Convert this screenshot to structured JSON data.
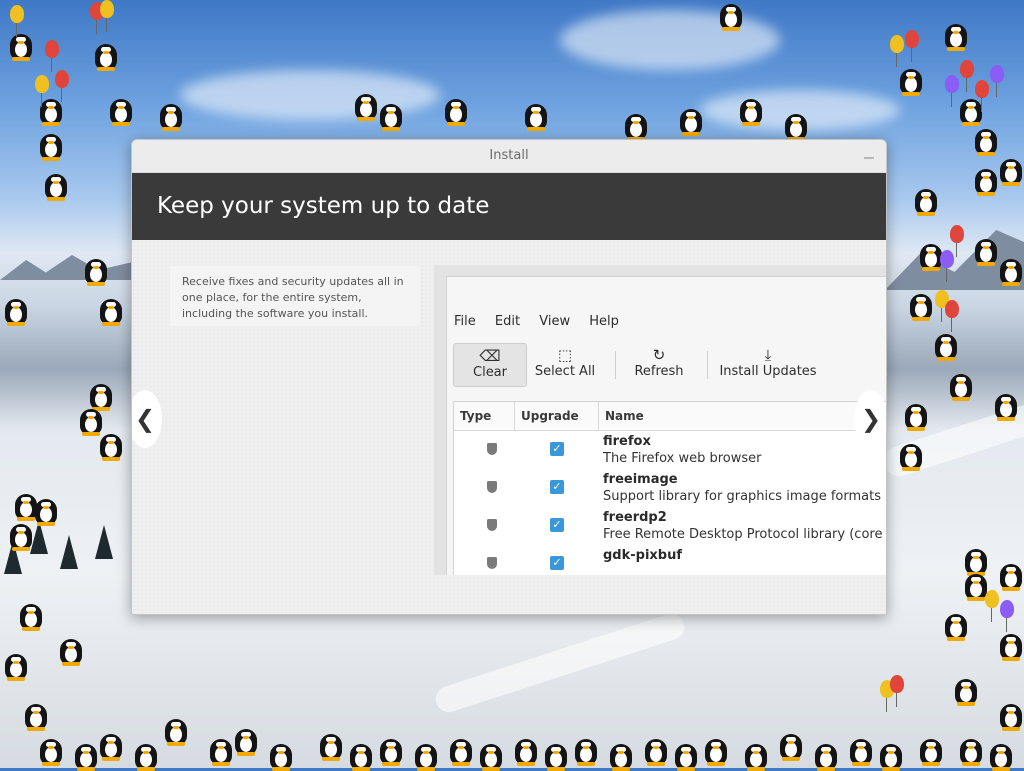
{
  "window": {
    "title": "Install"
  },
  "header": {
    "heading": "Keep your system up to date"
  },
  "description": "Receive fixes and security updates all in one place, for the entire system, including the software you install.",
  "screenshot": {
    "menu": [
      "File",
      "Edit",
      "View",
      "Help"
    ],
    "toolbar": [
      {
        "label": "Clear",
        "icon": "backspace-icon"
      },
      {
        "label": "Select All",
        "icon": "select-all-icon"
      },
      {
        "label": "Refresh",
        "icon": "refresh-icon"
      },
      {
        "label": "Install Updates",
        "icon": "download-icon"
      }
    ],
    "columns": [
      "Type",
      "Upgrade",
      "Name"
    ],
    "packages": [
      {
        "name": "firefox",
        "description": "The Firefox web browser"
      },
      {
        "name": "freeimage",
        "description": "Support library for graphics image formats (libr"
      },
      {
        "name": "freerdp2",
        "description": "Free Remote Desktop Protocol library (core libr"
      },
      {
        "name": "gdk-pixbuf",
        "description": ""
      }
    ]
  },
  "nav": {
    "prev_icon": "chevron-left-icon",
    "next_icon": "chevron-right-icon"
  },
  "colors": {
    "header_bg": "#3a3a3a",
    "checkbox": "#3b98d8",
    "window_bg": "#f0f0f0"
  }
}
